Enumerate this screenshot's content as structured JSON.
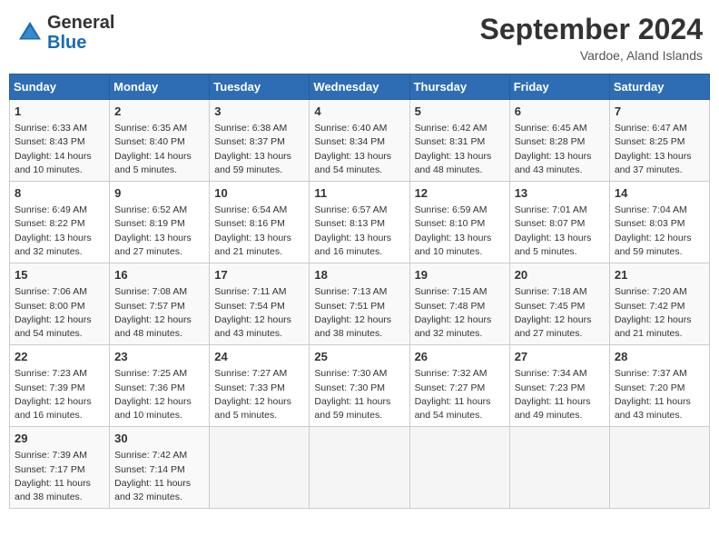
{
  "header": {
    "logo_general": "General",
    "logo_blue": "Blue",
    "month_title": "September 2024",
    "location": "Vardoe, Aland Islands"
  },
  "weekdays": [
    "Sunday",
    "Monday",
    "Tuesday",
    "Wednesday",
    "Thursday",
    "Friday",
    "Saturday"
  ],
  "weeks": [
    [
      {
        "day": "1",
        "info": "Sunrise: 6:33 AM\nSunset: 8:43 PM\nDaylight: 14 hours\nand 10 minutes."
      },
      {
        "day": "2",
        "info": "Sunrise: 6:35 AM\nSunset: 8:40 PM\nDaylight: 14 hours\nand 5 minutes."
      },
      {
        "day": "3",
        "info": "Sunrise: 6:38 AM\nSunset: 8:37 PM\nDaylight: 13 hours\nand 59 minutes."
      },
      {
        "day": "4",
        "info": "Sunrise: 6:40 AM\nSunset: 8:34 PM\nDaylight: 13 hours\nand 54 minutes."
      },
      {
        "day": "5",
        "info": "Sunrise: 6:42 AM\nSunset: 8:31 PM\nDaylight: 13 hours\nand 48 minutes."
      },
      {
        "day": "6",
        "info": "Sunrise: 6:45 AM\nSunset: 8:28 PM\nDaylight: 13 hours\nand 43 minutes."
      },
      {
        "day": "7",
        "info": "Sunrise: 6:47 AM\nSunset: 8:25 PM\nDaylight: 13 hours\nand 37 minutes."
      }
    ],
    [
      {
        "day": "8",
        "info": "Sunrise: 6:49 AM\nSunset: 8:22 PM\nDaylight: 13 hours\nand 32 minutes."
      },
      {
        "day": "9",
        "info": "Sunrise: 6:52 AM\nSunset: 8:19 PM\nDaylight: 13 hours\nand 27 minutes."
      },
      {
        "day": "10",
        "info": "Sunrise: 6:54 AM\nSunset: 8:16 PM\nDaylight: 13 hours\nand 21 minutes."
      },
      {
        "day": "11",
        "info": "Sunrise: 6:57 AM\nSunset: 8:13 PM\nDaylight: 13 hours\nand 16 minutes."
      },
      {
        "day": "12",
        "info": "Sunrise: 6:59 AM\nSunset: 8:10 PM\nDaylight: 13 hours\nand 10 minutes."
      },
      {
        "day": "13",
        "info": "Sunrise: 7:01 AM\nSunset: 8:07 PM\nDaylight: 13 hours\nand 5 minutes."
      },
      {
        "day": "14",
        "info": "Sunrise: 7:04 AM\nSunset: 8:03 PM\nDaylight: 12 hours\nand 59 minutes."
      }
    ],
    [
      {
        "day": "15",
        "info": "Sunrise: 7:06 AM\nSunset: 8:00 PM\nDaylight: 12 hours\nand 54 minutes."
      },
      {
        "day": "16",
        "info": "Sunrise: 7:08 AM\nSunset: 7:57 PM\nDaylight: 12 hours\nand 48 minutes."
      },
      {
        "day": "17",
        "info": "Sunrise: 7:11 AM\nSunset: 7:54 PM\nDaylight: 12 hours\nand 43 minutes."
      },
      {
        "day": "18",
        "info": "Sunrise: 7:13 AM\nSunset: 7:51 PM\nDaylight: 12 hours\nand 38 minutes."
      },
      {
        "day": "19",
        "info": "Sunrise: 7:15 AM\nSunset: 7:48 PM\nDaylight: 12 hours\nand 32 minutes."
      },
      {
        "day": "20",
        "info": "Sunrise: 7:18 AM\nSunset: 7:45 PM\nDaylight: 12 hours\nand 27 minutes."
      },
      {
        "day": "21",
        "info": "Sunrise: 7:20 AM\nSunset: 7:42 PM\nDaylight: 12 hours\nand 21 minutes."
      }
    ],
    [
      {
        "day": "22",
        "info": "Sunrise: 7:23 AM\nSunset: 7:39 PM\nDaylight: 12 hours\nand 16 minutes."
      },
      {
        "day": "23",
        "info": "Sunrise: 7:25 AM\nSunset: 7:36 PM\nDaylight: 12 hours\nand 10 minutes."
      },
      {
        "day": "24",
        "info": "Sunrise: 7:27 AM\nSunset: 7:33 PM\nDaylight: 12 hours\nand 5 minutes."
      },
      {
        "day": "25",
        "info": "Sunrise: 7:30 AM\nSunset: 7:30 PM\nDaylight: 11 hours\nand 59 minutes."
      },
      {
        "day": "26",
        "info": "Sunrise: 7:32 AM\nSunset: 7:27 PM\nDaylight: 11 hours\nand 54 minutes."
      },
      {
        "day": "27",
        "info": "Sunrise: 7:34 AM\nSunset: 7:23 PM\nDaylight: 11 hours\nand 49 minutes."
      },
      {
        "day": "28",
        "info": "Sunrise: 7:37 AM\nSunset: 7:20 PM\nDaylight: 11 hours\nand 43 minutes."
      }
    ],
    [
      {
        "day": "29",
        "info": "Sunrise: 7:39 AM\nSunset: 7:17 PM\nDaylight: 11 hours\nand 38 minutes."
      },
      {
        "day": "30",
        "info": "Sunrise: 7:42 AM\nSunset: 7:14 PM\nDaylight: 11 hours\nand 32 minutes."
      },
      {
        "day": "",
        "info": ""
      },
      {
        "day": "",
        "info": ""
      },
      {
        "day": "",
        "info": ""
      },
      {
        "day": "",
        "info": ""
      },
      {
        "day": "",
        "info": ""
      }
    ]
  ]
}
